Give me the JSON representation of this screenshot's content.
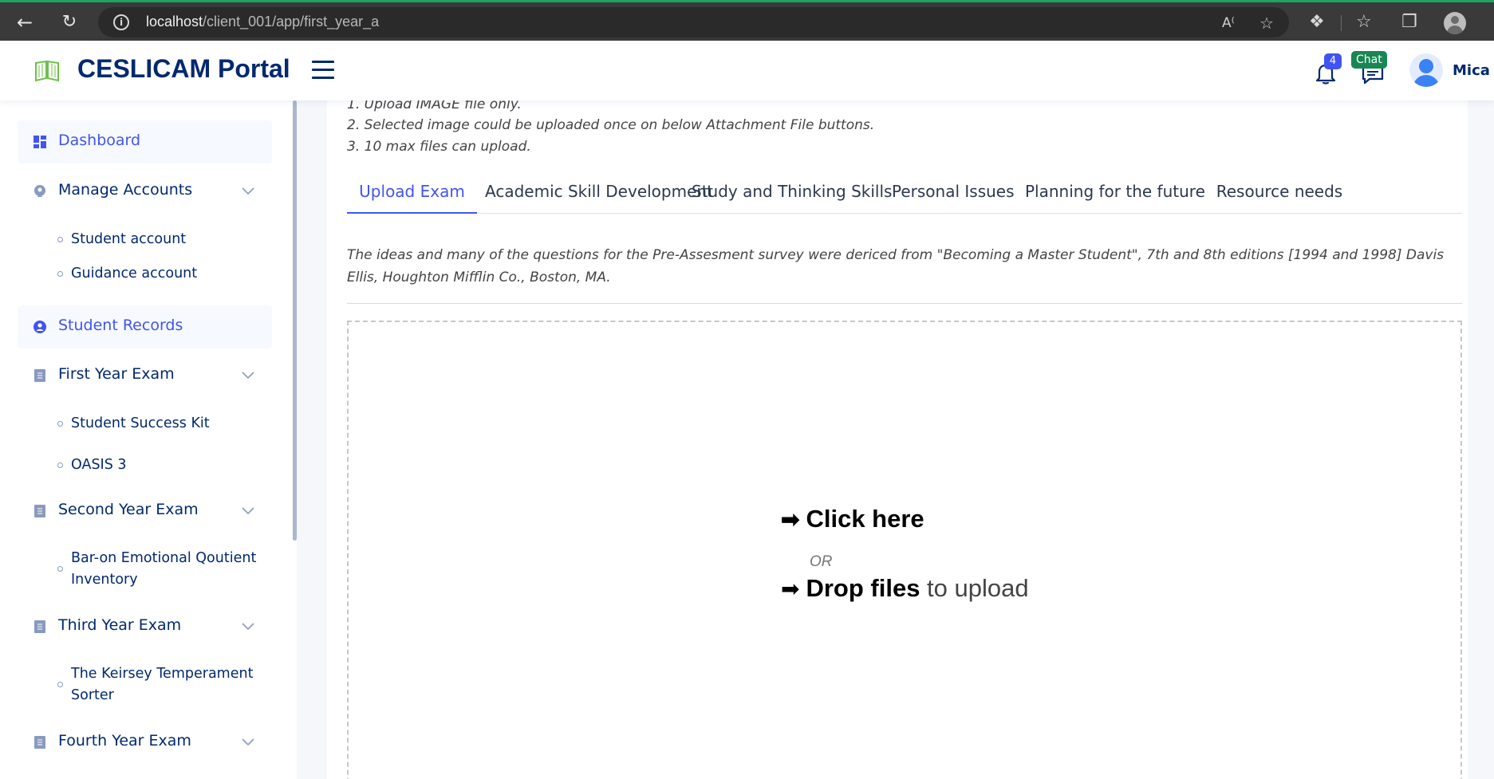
{
  "browser": {
    "url_host": "localhost",
    "url_path": "/client_001/app/first_year_a"
  },
  "header": {
    "brand": "CESLICAM Portal",
    "notification_count": "4",
    "chat_label": "Chat",
    "user_name": "Mica"
  },
  "sidebar": {
    "items": [
      {
        "label": "Dashboard"
      },
      {
        "label": "Manage Accounts"
      },
      {
        "label": "Student account"
      },
      {
        "label": "Guidance account"
      },
      {
        "label": "Student Records"
      },
      {
        "label": "First Year Exam"
      },
      {
        "label": "Student Success Kit"
      },
      {
        "label": "OASIS 3"
      },
      {
        "label": "Second Year Exam"
      },
      {
        "label": "Bar-on Emotional Qoutient Inventory"
      },
      {
        "label": "Third Year Exam"
      },
      {
        "label": "The Keirsey Temperament Sorter"
      },
      {
        "label": "Fourth Year Exam"
      }
    ]
  },
  "main": {
    "instructions": [
      "1. Upload IMAGE file only.",
      "2. Selected image could be uploaded once on below Attachment File buttons.",
      "3. 10 max files can upload."
    ],
    "tabs": [
      {
        "label": "Upload Exam"
      },
      {
        "label": "Academic Skill Development"
      },
      {
        "label": "Study and Thinking Skills"
      },
      {
        "label": "Personal Issues"
      },
      {
        "label": "Planning for the future"
      },
      {
        "label": "Resource needs"
      }
    ],
    "note": "The ideas and many of the questions for the Pre-Assesment survey were dericed from \"Becoming a Master Student\", 7th and 8th editions [1994 and 1998] Davis Ellis, Houghton Mifflin Co., Boston, MA.",
    "dropzone": {
      "click_text": "Click here",
      "or_text": "OR",
      "drop_bold": "Drop files",
      "drop_rest": " to upload"
    }
  }
}
